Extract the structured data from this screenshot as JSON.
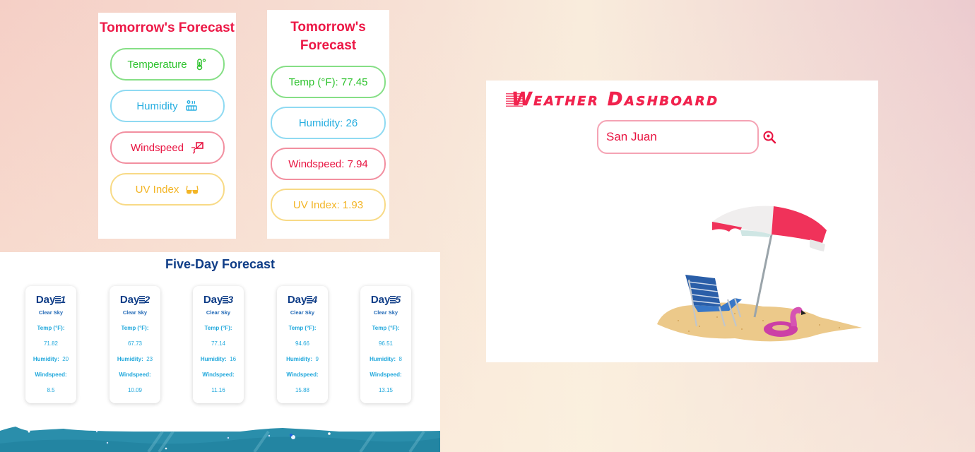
{
  "tomorrow_labels_panel": {
    "title": "Tomorrow's Forecast",
    "items": [
      {
        "label": "Temperature",
        "icon": "thermometer-icon",
        "color": "#2cc22c"
      },
      {
        "label": "Humidity",
        "icon": "humidity-icon",
        "color": "#26aee0"
      },
      {
        "label": "Windspeed",
        "icon": "wind-kite-icon",
        "color": "#e81340"
      },
      {
        "label": "UV Index",
        "icon": "sunglasses-icon",
        "color": "#f3b526"
      }
    ]
  },
  "tomorrow_values_panel": {
    "title": "Tomorrow's Forecast",
    "items": [
      {
        "label": "Temp (°F): 77.45",
        "color": "#2cc22c"
      },
      {
        "label": "Humidity: 26",
        "color": "#26aee0"
      },
      {
        "label": "Windspeed: 7.94",
        "color": "#e81340"
      },
      {
        "label": "UV Index: 1.93",
        "color": "#f3b526"
      }
    ]
  },
  "five_day": {
    "title": "Five-Day Forecast",
    "temp_label": "Temp (°F):",
    "humidity_label": "Humidity:",
    "windspeed_label": "Windspeed:",
    "days": [
      {
        "day_label": "Day",
        "day_number": "1",
        "condition": "Clear Sky",
        "temp": "71.82",
        "humidity": "20",
        "windspeed": "8.5"
      },
      {
        "day_label": "Day",
        "day_number": "2",
        "condition": "Clear Sky",
        "temp": "67.73",
        "humidity": "23",
        "windspeed": "10.09"
      },
      {
        "day_label": "Day",
        "day_number": "3",
        "condition": "Clear Sky",
        "temp": "77.14",
        "humidity": "16",
        "windspeed": "11.16"
      },
      {
        "day_label": "Day",
        "day_number": "4",
        "condition": "Clear Sky",
        "temp": "94.66",
        "humidity": "9",
        "windspeed": "15.88"
      },
      {
        "day_label": "Day",
        "day_number": "5",
        "condition": "Clear Sky",
        "temp": "96.51",
        "humidity": "8",
        "windspeed": "13.15"
      }
    ]
  },
  "dashboard": {
    "title": "Weather Dashboard",
    "search_value": "San Juan",
    "search_icon": "search-location-icon",
    "illustration": "beach-umbrella-chair-flamingo"
  },
  "colors": {
    "accent_red": "#e81340",
    "navy": "#0f3d87",
    "sky_blue": "#21a8dc"
  }
}
